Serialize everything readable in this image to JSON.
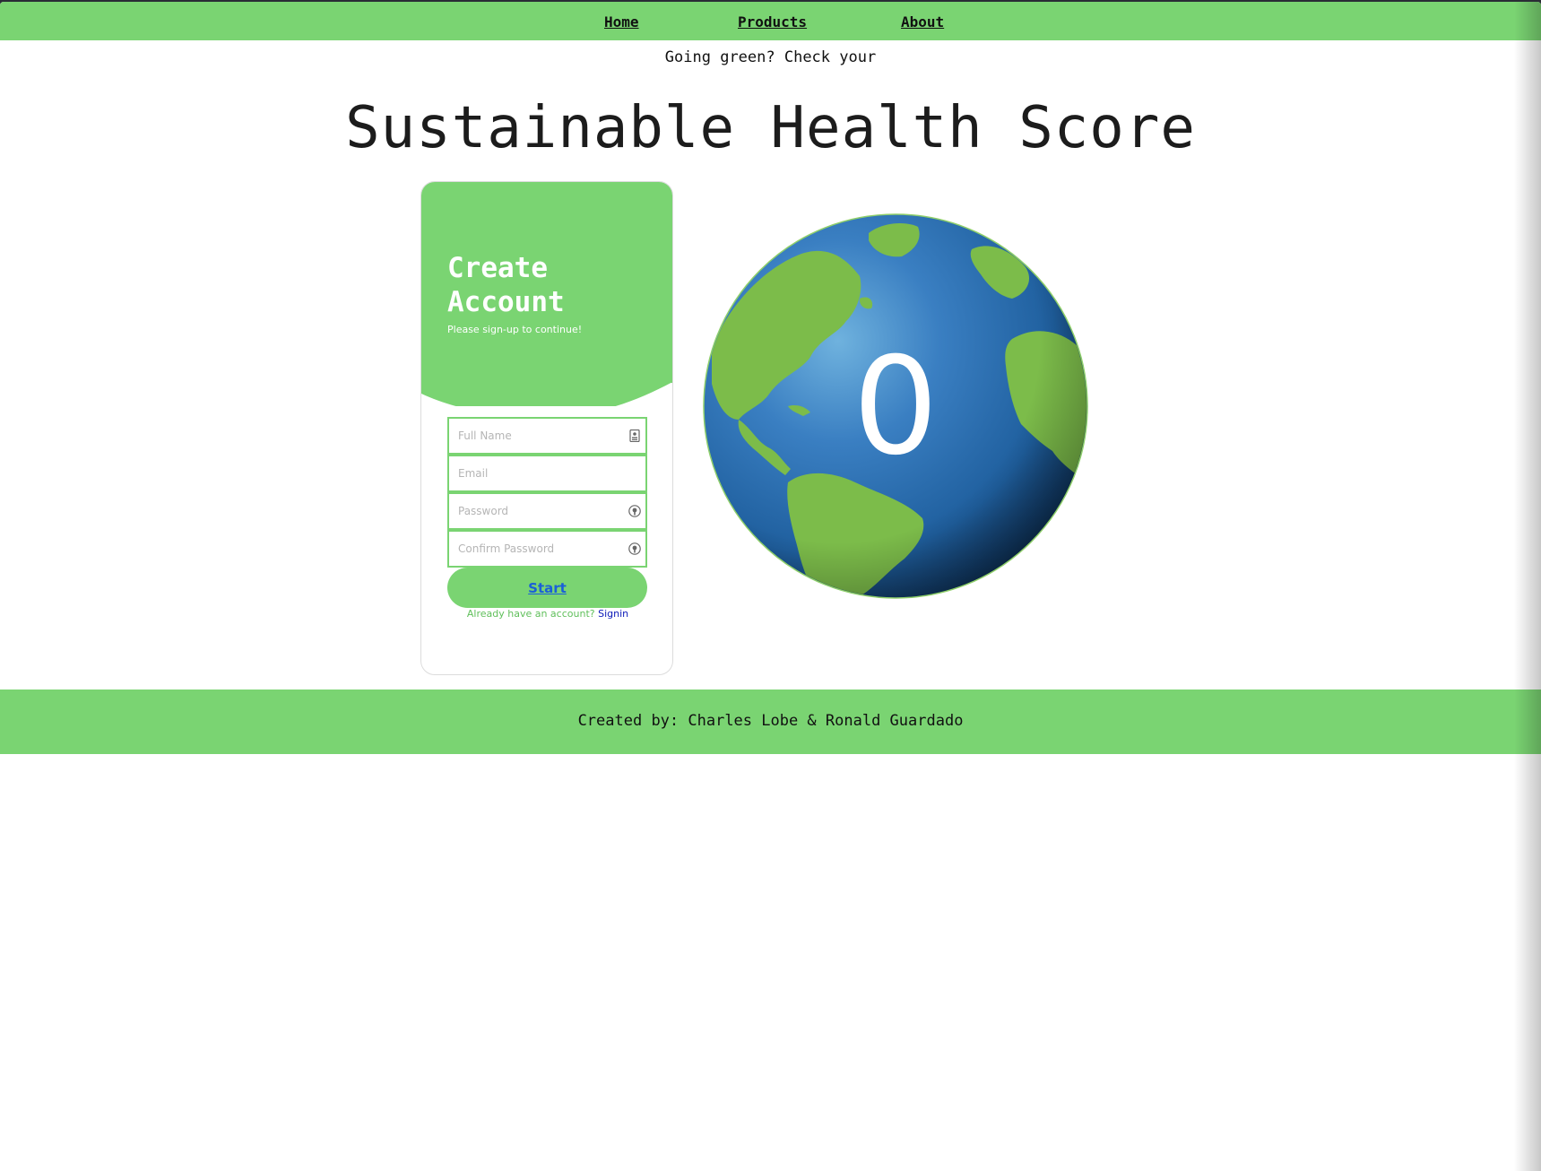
{
  "nav": {
    "home_label": "Home",
    "products_label": "Products",
    "about_label": "About"
  },
  "tagline": "Going green? Check your",
  "title": "Sustainable Health Score",
  "signup": {
    "title": "Create Account",
    "subtitle": "Please sign-up to continue!",
    "full_name_placeholder": "Full Name",
    "email_placeholder": "Email",
    "password_placeholder": "Password",
    "confirm_password_placeholder": "Confirm Password",
    "start_label": "Start",
    "signin_prompt": "Already have an account?",
    "signin_label": "Signin"
  },
  "score": "0",
  "footer": {
    "credits": "Created by: Charles Lobe & Ronald Guardado"
  },
  "colors": {
    "accent_green": "#7ad472",
    "ocean_blue": "#2a6fb4",
    "link_blue": "#1a5fd8"
  },
  "icons": {
    "full_name": "id-card-icon",
    "password": "lock-icon",
    "confirm_password": "lock-icon"
  }
}
